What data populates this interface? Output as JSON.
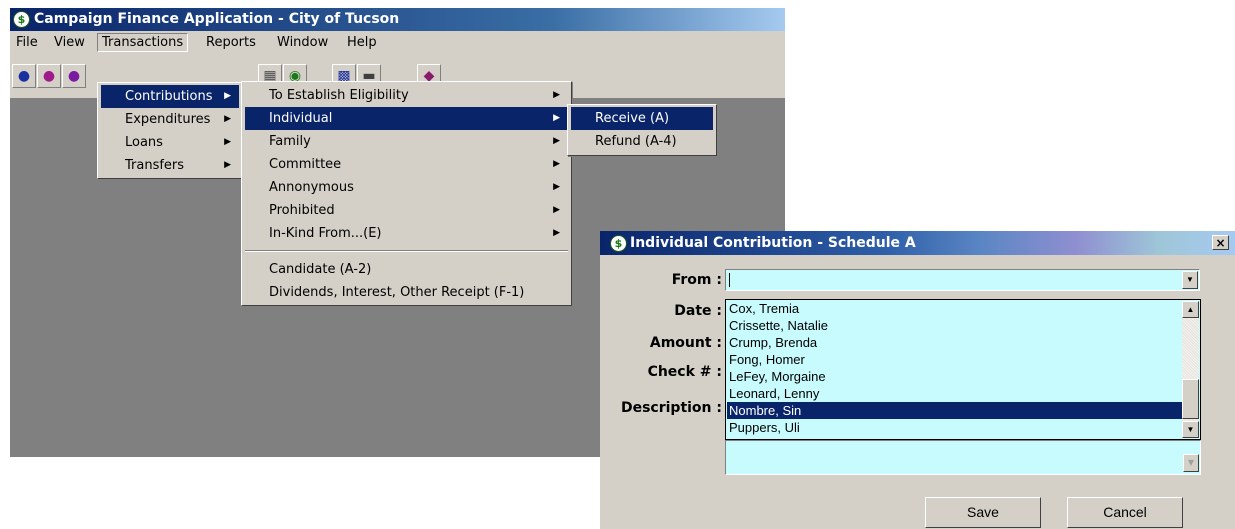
{
  "app": {
    "title": "Campaign Finance Application - City of Tucson",
    "menus": [
      "File",
      "View",
      "Transactions",
      "Reports",
      "Window",
      "Help"
    ],
    "toolbar_icons": [
      "person-icon",
      "people-icon",
      "group-icon",
      "document-icon",
      "globe-icon",
      "calculator-icon",
      "printer-icon",
      "book-icon"
    ]
  },
  "transactions_menu": {
    "items": [
      "Contributions",
      "Expenditures",
      "Loans",
      "Transfers"
    ],
    "highlighted": "Contributions"
  },
  "contributions_menu": {
    "items": [
      "To Establish Eligibility",
      "Individual",
      "Family",
      "Committee",
      "Annonymous",
      "Prohibited",
      "In-Kind From...(E)"
    ],
    "items_after_separator": [
      "Candidate (A-2)",
      "Dividends, Interest, Other Receipt (F-1)"
    ],
    "highlighted": "Individual"
  },
  "individual_menu": {
    "items": [
      "Receive (A)",
      "Refund (A-4)"
    ],
    "highlighted": "Receive (A)"
  },
  "dialog": {
    "title": "Individual Contribution - Schedule A",
    "close_symbol": "×",
    "labels": {
      "from": "From :",
      "date": "Date :",
      "amount": "Amount :",
      "check": "Check # :",
      "description": "Description :"
    },
    "from_value": "",
    "dropdown_items": [
      "Cox, Tremia",
      "Crissette, Natalie",
      "Crump, Brenda",
      "Fong, Homer",
      "LeFey, Morgaine",
      "Leonard, Lenny",
      "Nombre, Sin",
      "Puppers, Uli"
    ],
    "selected_item": "Nombre, Sin",
    "buttons": {
      "save": "Save",
      "cancel": "Cancel"
    }
  },
  "colors": {
    "title_bar": "#0a246a",
    "menu_highlight": "#0a246a",
    "input_background": "#c8fbfd",
    "window_background": "#d4d0c8",
    "workspace": "#808080"
  }
}
